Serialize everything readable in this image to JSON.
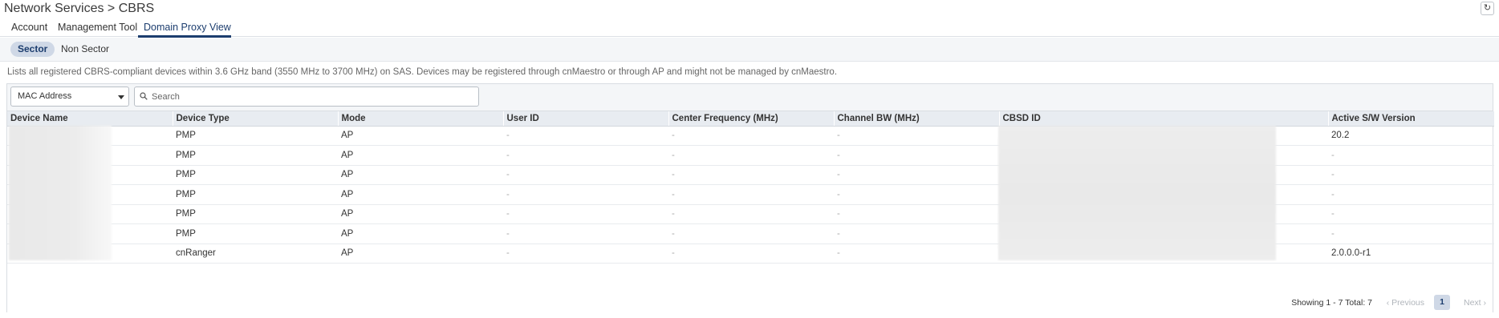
{
  "header": {
    "title": "Network Services > CBRS",
    "refresh_icon": "refresh-icon"
  },
  "tabs": [
    {
      "label": "Account"
    },
    {
      "label": "Management Tool"
    },
    {
      "label": "Domain Proxy View",
      "active": true
    }
  ],
  "subtabs": [
    {
      "label": "Sector",
      "active": true
    },
    {
      "label": "Non Sector"
    }
  ],
  "description": "Lists all registered CBRS-compliant devices within 3.6 GHz band (3550 MHz to 3700 MHz) on SAS. Devices may be registered through cnMaestro or through AP and might not be managed by cnMaestro.",
  "filter": {
    "selected": "MAC Address",
    "search_placeholder": "Search"
  },
  "table": {
    "columns": [
      "Device Name",
      "Device Type",
      "Mode",
      "User ID",
      "Center Frequency (MHz)",
      "Channel BW (MHz)",
      "CBSD ID",
      "Active S/W Version"
    ],
    "rows": [
      {
        "device_type": "PMP",
        "mode": "AP",
        "user_id": "-",
        "center_freq": "-",
        "channel_bw": "-",
        "sw_version": "20.2"
      },
      {
        "device_type": "PMP",
        "mode": "AP",
        "user_id": "-",
        "center_freq": "-",
        "channel_bw": "-",
        "sw_version": "-"
      },
      {
        "device_type": "PMP",
        "mode": "AP",
        "user_id": "-",
        "center_freq": "-",
        "channel_bw": "-",
        "sw_version": "-"
      },
      {
        "device_type": "PMP",
        "mode": "AP",
        "user_id": "-",
        "center_freq": "-",
        "channel_bw": "-",
        "sw_version": "-"
      },
      {
        "device_type": "PMP",
        "mode": "AP",
        "user_id": "-",
        "center_freq": "-",
        "channel_bw": "-",
        "sw_version": "-"
      },
      {
        "device_type": "PMP",
        "mode": "AP",
        "user_id": "-",
        "center_freq": "-",
        "channel_bw": "-",
        "sw_version": "-"
      },
      {
        "device_type": "cnRanger",
        "mode": "AP",
        "user_id": "-",
        "center_freq": "-",
        "channel_bw": "-",
        "sw_version": "2.0.0.0-r1"
      }
    ]
  },
  "pagination": {
    "showing": "Showing 1 - 7 Total: 7",
    "previous": "‹ Previous",
    "page": "1",
    "next": "Next ›"
  }
}
